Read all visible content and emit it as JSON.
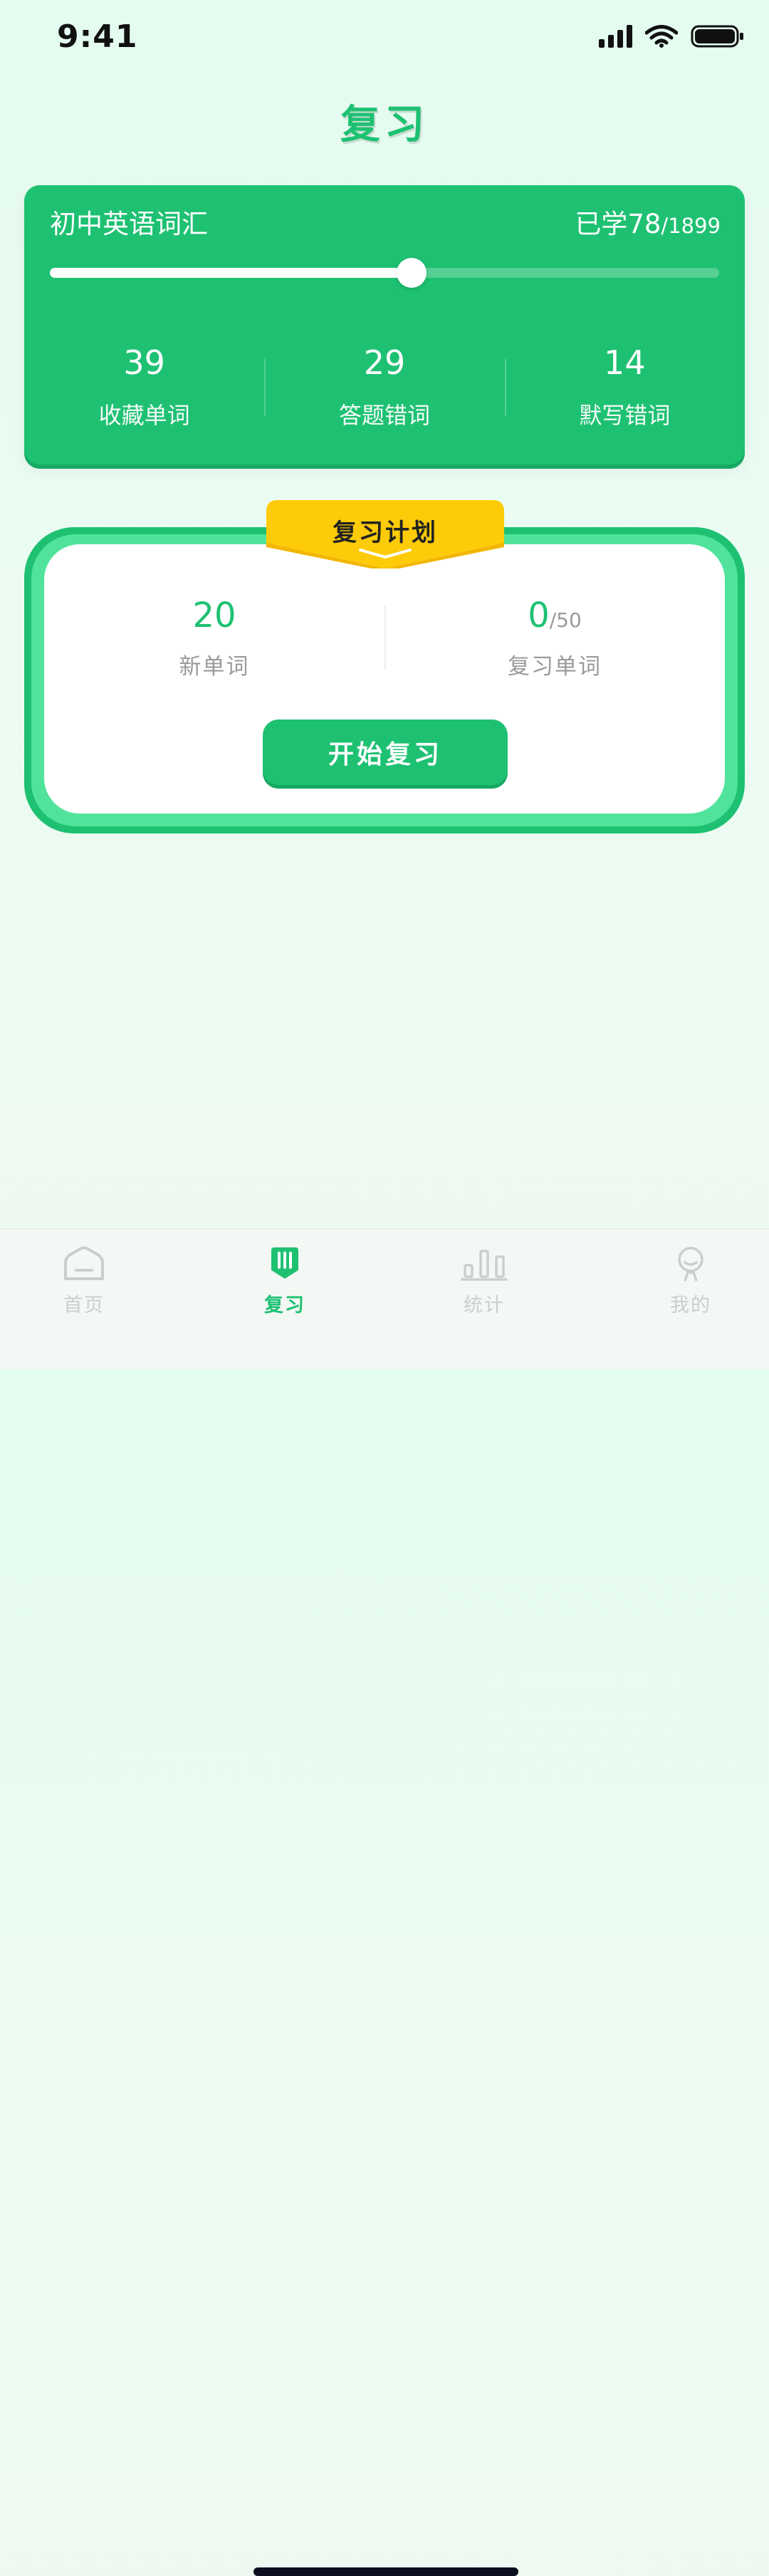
{
  "status_bar": {
    "time": "9:41"
  },
  "page": {
    "title": "复习"
  },
  "stats_card": {
    "book_name": "初中英语词汇",
    "learned_prefix": "已学",
    "learned_count": "78",
    "learned_total": "/1899",
    "progress_fraction": 0.54,
    "stats": [
      {
        "value": "39",
        "label": "收藏单词"
      },
      {
        "value": "29",
        "label": "答题错词"
      },
      {
        "value": "14",
        "label": "默写错词"
      }
    ]
  },
  "plan_card": {
    "title": "复习计划",
    "new_words": {
      "value": "20",
      "label": "新单词"
    },
    "review_words": {
      "value": "0",
      "total": "/50",
      "label": "复习单词"
    },
    "start_button": "开始复习"
  },
  "tab_bar": {
    "tabs": [
      {
        "label": "首页",
        "icon": "home-icon",
        "active": false
      },
      {
        "label": "复习",
        "icon": "review-book-icon",
        "active": true
      },
      {
        "label": "统计",
        "icon": "bar-chart-icon",
        "active": false
      },
      {
        "label": "我的",
        "icon": "profile-icon",
        "active": false
      }
    ]
  },
  "colors": {
    "accent": "#1ec172",
    "accent_light": "#51e39c",
    "ribbon": "#fdcb08",
    "inactive_tab": "#c9cfcb"
  }
}
